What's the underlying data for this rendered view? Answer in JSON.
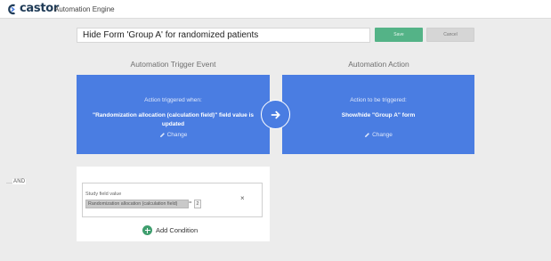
{
  "header": {
    "logo_text": "castor",
    "app_title": "Automation Engine"
  },
  "form": {
    "title_value": "Hide Form 'Group A' for randomized patients",
    "save_label": "Save",
    "cancel_label": "Cancel"
  },
  "trigger": {
    "heading": "Automation Trigger Event",
    "caption": "Action triggered when:",
    "description": "\"Randomization allocation (calculation field)\" field value is updated",
    "change_label": "Change"
  },
  "action": {
    "heading": "Automation Action",
    "caption": "Action to be triggered:",
    "description": "Show/hide \"Group A\" form",
    "change_label": "Change"
  },
  "conditions": {
    "group_label": "AND",
    "field_type_label": "Study field value",
    "field_name": "Randomization allocation (calculation field)",
    "operator": "=",
    "value": "2",
    "remove_symbol": "×",
    "add_label": "Add Condition"
  },
  "colors": {
    "accent_blue": "#4a7de2",
    "save_green": "#54b387",
    "add_green": "#3f9e6e",
    "brand_navy": "#1f3b57"
  },
  "icons": [
    "castor-logo-icon",
    "pencil-icon",
    "arrow-right-icon",
    "close-icon",
    "plus-circle-icon"
  ]
}
